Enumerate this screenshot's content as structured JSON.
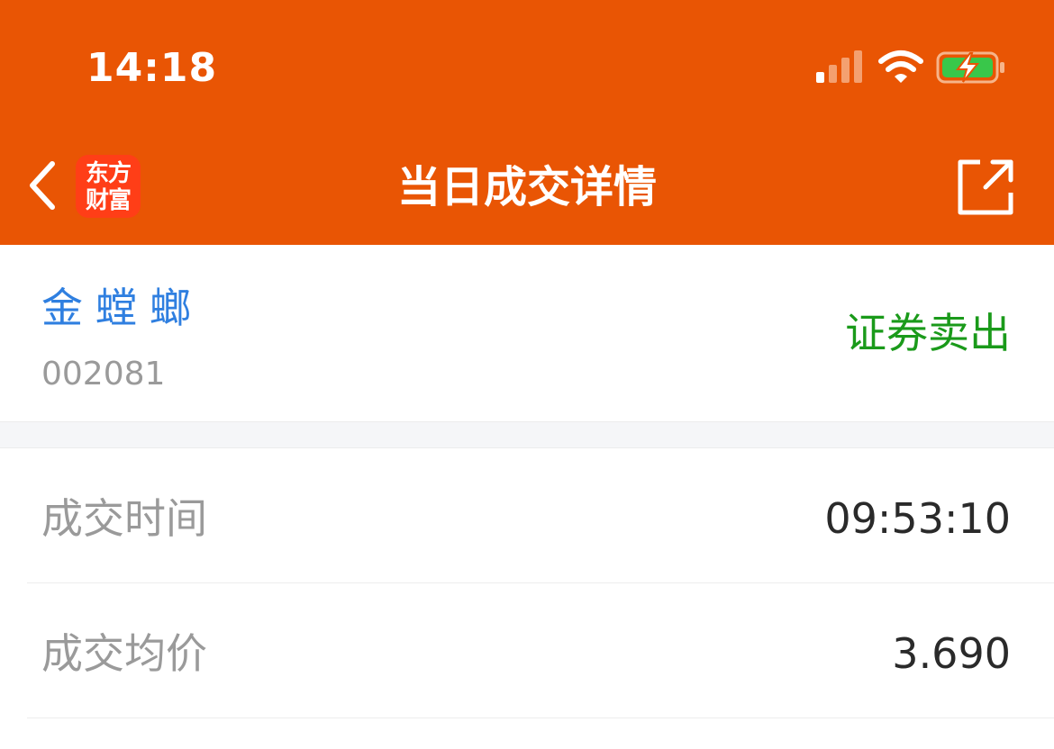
{
  "status_bar": {
    "time": "14:18",
    "icons": [
      "signal-icon",
      "wifi-icon",
      "battery-charging-icon"
    ]
  },
  "nav": {
    "back_icon": "chevron-left-icon",
    "logo_line1": "东方",
    "logo_line2": "财富",
    "title": "当日成交详情",
    "share_icon": "share-external-icon"
  },
  "stock": {
    "name": "金螳螂",
    "code": "002081",
    "trade_type": "证券卖出"
  },
  "details": [
    {
      "label": "成交时间",
      "value": "09:53:10"
    },
    {
      "label": "成交均价",
      "value": "3.690"
    }
  ],
  "colors": {
    "brand_orange": "#e95504",
    "logo_red": "#ff3e17",
    "stock_name_blue": "#2f7fe0",
    "sell_green": "#1a9a1a",
    "label_gray": "#9a9a9a",
    "value_dark": "#2a2a2a",
    "battery_green": "#39c74a"
  }
}
